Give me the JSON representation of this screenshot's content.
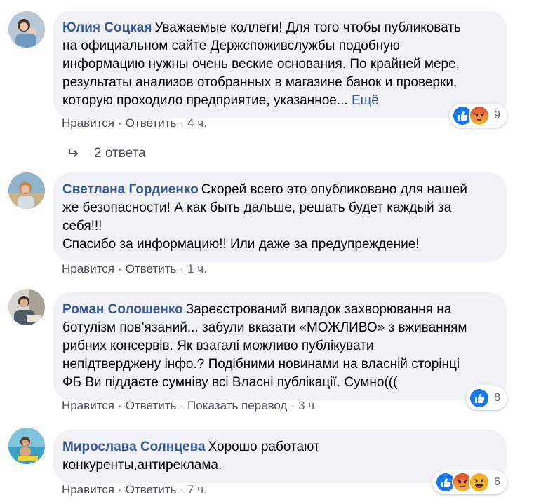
{
  "comments": [
    {
      "author": "Юлия Соцкая",
      "text_lines": [
        "Уважаемые коллеги! Для того чтобы публиковать",
        "на официальном сайте Держспоживслужбы подобную",
        "информацию нужны очень веские основания. По крайней мере,",
        "результаты анализов отобранных в магазине банок и проверки,",
        "которую проходило предприятие, указанное..."
      ],
      "more_label": "Ещё",
      "like_label": "Нравится",
      "reply_label": "Ответить",
      "time": "4 ч.",
      "reactions": [
        "like-icon",
        "angry-icon"
      ],
      "reaction_count": "9"
    },
    {
      "author": "Светлана Гордиенко",
      "text_lines": [
        "Скорей всего это опубликовано для нашей",
        "же безопасности! А как быть дальше, решать будет каждый за",
        "себя!!!",
        "Спасибо за информацию!! Или даже за предупреждение!"
      ],
      "like_label": "Нравится",
      "reply_label": "Ответить",
      "time": "1 ч."
    },
    {
      "author": "Роман Солошенко",
      "text_lines": [
        "Зареєстрований випадок захворювання на",
        "ботулізм пов’язаний... забули вказати «МОЖЛИВО» з вживанням",
        "рибних консервів. Як взагалі можливо публікувати",
        "непідтверджену інфо.? Подібними новинами на власній сторінці",
        "ФБ Ви піддаєте сумніву всі Власні публікації. Сумно((("
      ],
      "like_label": "Нравится",
      "reply_label": "Ответить",
      "translate_label": "Показать перевод",
      "time": "3 ч.",
      "reactions": [
        "like-icon"
      ],
      "reaction_count": "8"
    },
    {
      "author": "Мирослава Солнцева",
      "text_lines": [
        "Хорошо работают",
        "конкуренты,антиреклама."
      ],
      "like_label": "Нравится",
      "reply_label": "Ответить",
      "time": "7 ч.",
      "reactions": [
        "like-icon",
        "angry-icon",
        "haha-icon"
      ],
      "reaction_count": "6"
    }
  ],
  "replies_label": "2 ответа",
  "colors": {
    "author": "#385898",
    "bubble": "#f0f2f5",
    "like": "#1877f2",
    "angry": "#e9710f",
    "haha": "#f7b125",
    "meta": "#65676b"
  }
}
